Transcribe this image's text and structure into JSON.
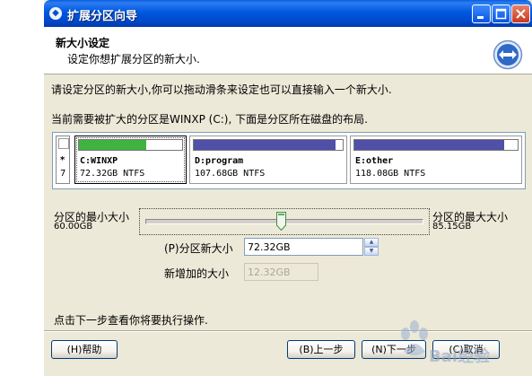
{
  "window": {
    "title": "扩展分区向导"
  },
  "header": {
    "title": "新大小设定",
    "subtitle": "设定你想扩展分区的新大小."
  },
  "body": {
    "instruction": "请设定分区的新大小,你可以拖动滑条来设定也可以直接输入一个新大小.",
    "layout_note": "当前需要被扩大的分区是WINXP (C:), 下面是分区所在磁盘的布局."
  },
  "disk": {
    "marker": "*",
    "number": "7",
    "partitions": [
      {
        "name": "C:WINXP",
        "size": "72.32GB NTFS",
        "used_fraction": 0.65,
        "used_color": "#3fb33f",
        "selected": true
      },
      {
        "name": "D:program",
        "size": "107.68GB NTFS",
        "used_fraction": 0.95,
        "used_color": "#5050a8",
        "selected": false
      },
      {
        "name": "E:other",
        "size": "118.08GB NTFS",
        "used_fraction": 0.92,
        "used_color": "#5050a8",
        "selected": false
      }
    ]
  },
  "slider": {
    "min_label": "分区的最小大小",
    "min_value": "60.00GB",
    "max_label": "分区的最大大小",
    "max_value": "85.15GB",
    "position_fraction": 0.49
  },
  "new_size": {
    "label": "(P)分区新大小",
    "value": "72.32GB"
  },
  "added_size": {
    "label": "新增加的大小",
    "value": "12.32GB"
  },
  "footer_hint": "点击下一步查看你将要执行操作.",
  "buttons": {
    "help": "(H)帮助",
    "back": "(B)上一步",
    "next": "(N)下一步",
    "cancel": "(C)取消"
  },
  "watermark": "Bai经验"
}
